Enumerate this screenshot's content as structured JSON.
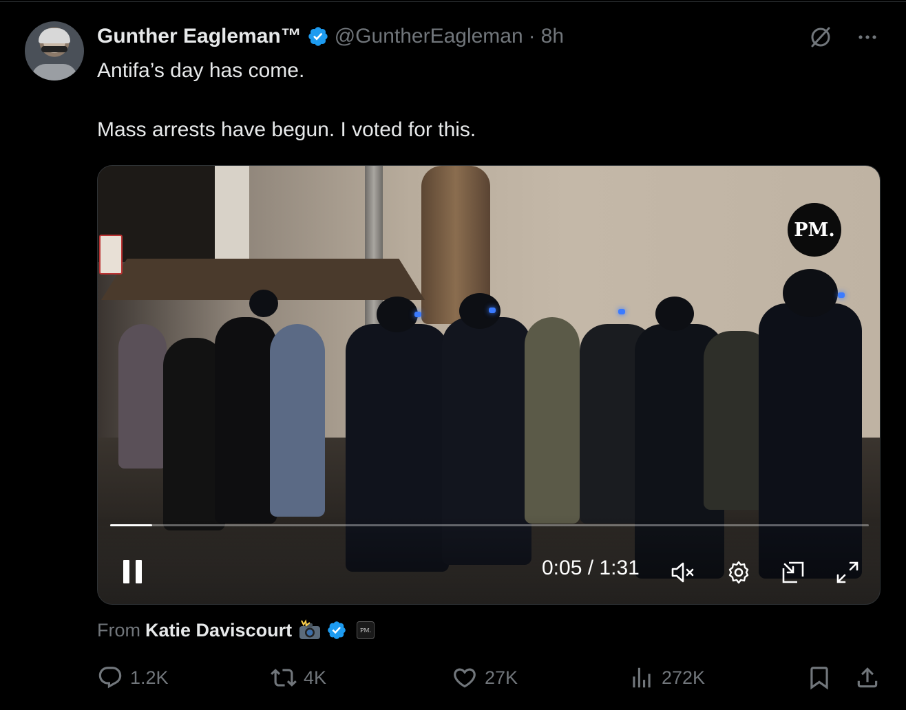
{
  "tweet": {
    "author_name": "Gunther Eagleman™",
    "handle": "@GuntherEagleman",
    "separator": "·",
    "time": "8h",
    "text_line_1": "Antifa’s day has come.",
    "text_line_2": "Mass arrests have begun. I voted for this.",
    "verified_color": "#1d9bf0"
  },
  "media": {
    "watermark": "PM.",
    "time_current": "0:05",
    "time_total": "1:31",
    "time_separator": "/",
    "progress_fraction": 0.055,
    "controls": [
      "pause-icon",
      "mute-icon",
      "settings-icon",
      "pip-icon",
      "fullscreen-icon"
    ]
  },
  "source": {
    "from_label": "From",
    "from_name": "Katie Daviscourt",
    "emoji": "camera-flash-emoji",
    "badge_text": "PM."
  },
  "actions": {
    "replies": "1.2K",
    "reposts": "4K",
    "likes": "27K",
    "views": "272K"
  }
}
